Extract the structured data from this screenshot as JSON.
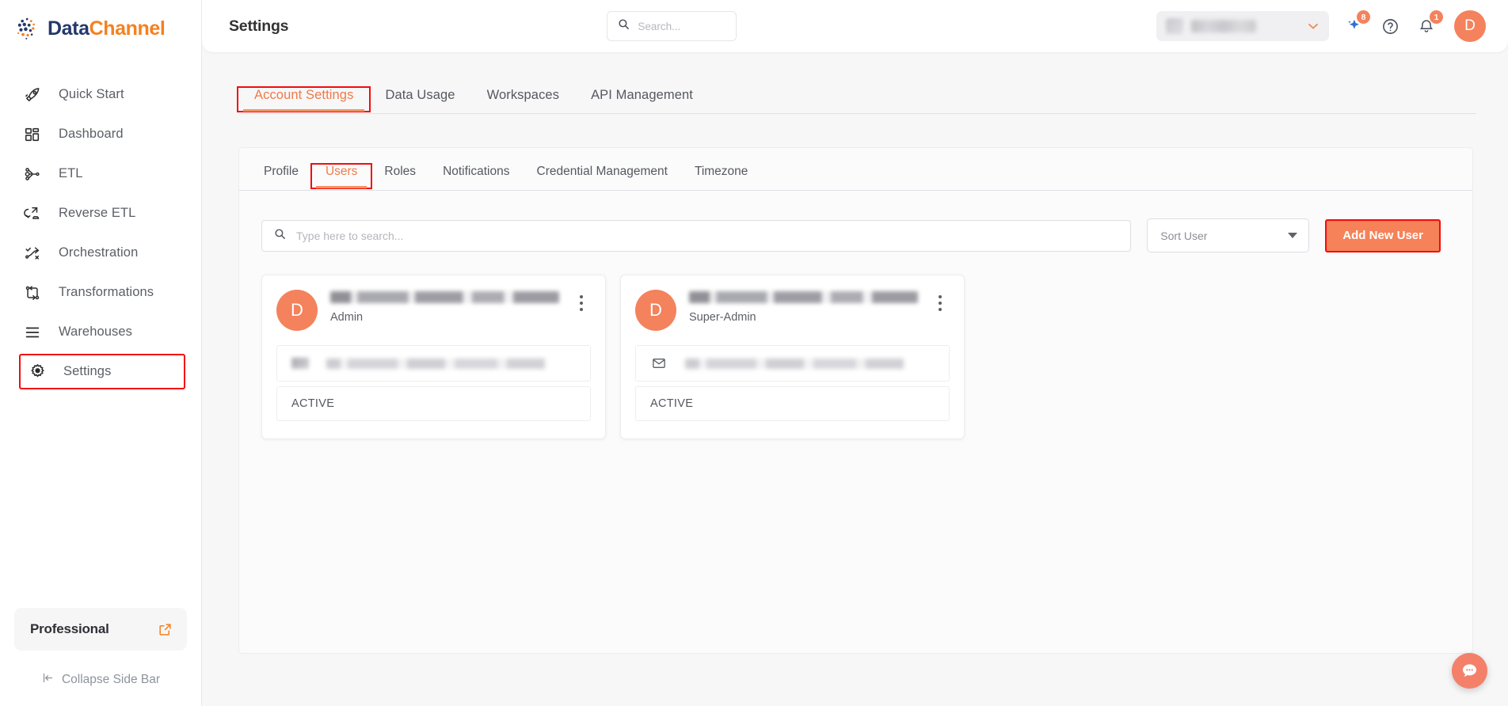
{
  "brand": {
    "part1": "Data",
    "part2": "Channel",
    "icon": "datachannel-logo-icon"
  },
  "sidebar": {
    "items": [
      {
        "label": "Quick Start",
        "icon": "rocket-icon",
        "highlighted": false
      },
      {
        "label": "Dashboard",
        "icon": "grid-icon",
        "highlighted": false
      },
      {
        "label": "ETL",
        "icon": "etl-branch-icon",
        "highlighted": false
      },
      {
        "label": "Reverse ETL",
        "icon": "reverse-etl-icon",
        "highlighted": false
      },
      {
        "label": "Orchestration",
        "icon": "orchestration-icon",
        "highlighted": false
      },
      {
        "label": "Transformations",
        "icon": "transform-icon",
        "highlighted": false
      },
      {
        "label": "Warehouses",
        "icon": "warehouse-icon",
        "highlighted": false
      },
      {
        "label": "Settings",
        "icon": "gear-icon",
        "highlighted": true
      }
    ],
    "plan": {
      "label": "Professional",
      "icon": "external-link-icon"
    },
    "collapse": {
      "label": "Collapse Side Bar",
      "icon": "collapse-left-icon"
    }
  },
  "topbar": {
    "title": "Settings",
    "search_placeholder": "Search...",
    "org_selector": {
      "value": "",
      "icon": "chevron-down-icon"
    },
    "ai_badge": "8",
    "notification_badge": "1",
    "help_icon": "question-circle-icon",
    "bell_icon": "bell-icon",
    "sparkle_icon": "sparkle-icon",
    "avatar_initial": "D"
  },
  "main_tabs": [
    {
      "label": "Account Settings",
      "active": true,
      "boxed": true
    },
    {
      "label": "Data Usage",
      "active": false,
      "boxed": false
    },
    {
      "label": "Workspaces",
      "active": false,
      "boxed": false
    },
    {
      "label": "API Management",
      "active": false,
      "boxed": false
    }
  ],
  "sub_tabs": [
    {
      "label": "Profile",
      "active": false,
      "boxed": false
    },
    {
      "label": "Users",
      "active": true,
      "boxed": true
    },
    {
      "label": "Roles",
      "active": false,
      "boxed": false
    },
    {
      "label": "Notifications",
      "active": false,
      "boxed": false
    },
    {
      "label": "Credential Management",
      "active": false,
      "boxed": false
    },
    {
      "label": "Timezone",
      "active": false,
      "boxed": false
    }
  ],
  "toolbar": {
    "search_placeholder": "Type here to search...",
    "search_value": "",
    "sort_label": "Sort User",
    "add_user_label": "Add New User"
  },
  "users": [
    {
      "avatar_initial": "D",
      "name": "",
      "role": "Admin",
      "email": "",
      "email_icon": "mail-icon",
      "status": "ACTIVE",
      "menu_icon": "kebab-menu-icon"
    },
    {
      "avatar_initial": "D",
      "name": "",
      "role": "Super-Admin",
      "email": "",
      "email_icon": "mail-icon",
      "status": "ACTIVE",
      "menu_icon": "kebab-menu-icon"
    }
  ],
  "chat": {
    "icon": "chat-bubble-icon"
  },
  "colors": {
    "accent_orange": "#f4825c",
    "brand_orange": "#f4811f",
    "brand_navy": "#24386b",
    "highlight_red": "#f40b0b",
    "tab_active": "#f07a48"
  }
}
